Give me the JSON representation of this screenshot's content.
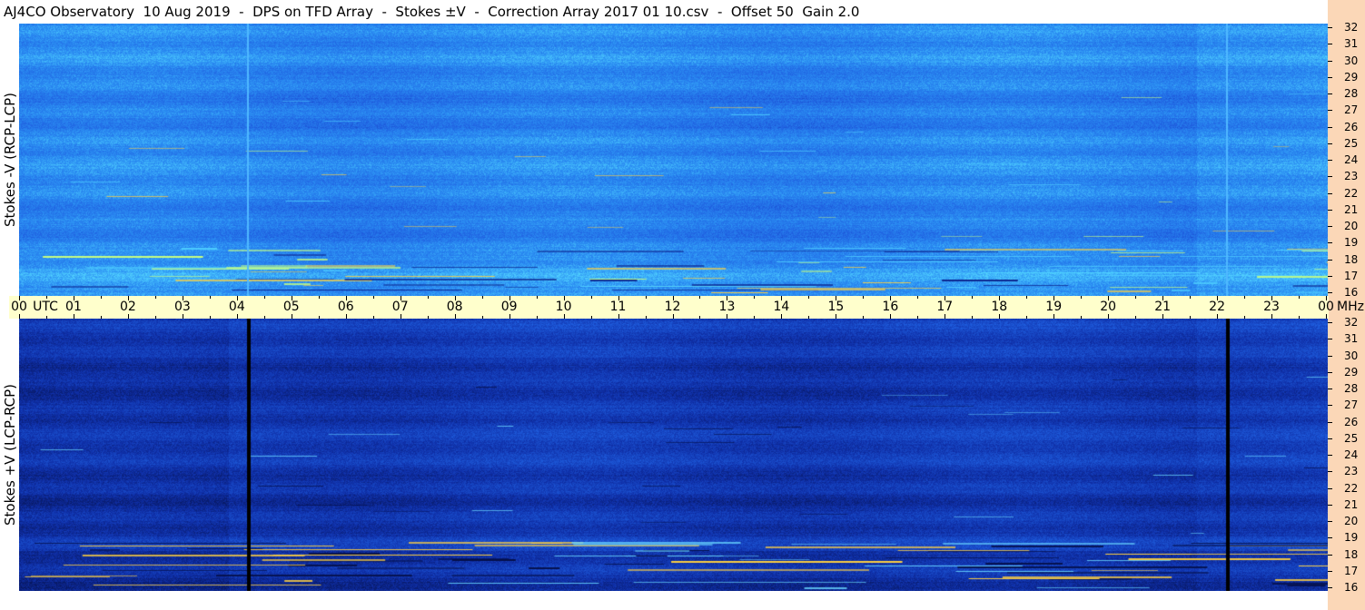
{
  "title": "AJ4CO Observatory  10 Aug 2019  -  DPS on TFD Array  -  Stokes ±V  -  Correction Array 2017 01 10.csv  -  Offset 50  Gain 2.0",
  "chart_data": [
    {
      "type": "heatmap",
      "panel": "top",
      "ylabel": "Stokes -V (RCP-LCP)",
      "x_unit": "UTC",
      "x_ticks": [
        "00",
        "01",
        "02",
        "03",
        "04",
        "05",
        "06",
        "07",
        "08",
        "09",
        "10",
        "11",
        "12",
        "13",
        "14",
        "15",
        "16",
        "17",
        "18",
        "19",
        "20",
        "21",
        "22",
        "23",
        "00"
      ],
      "y_unit": "MHz",
      "y_ticks": [
        "16",
        "17",
        "18",
        "19",
        "20",
        "21",
        "22",
        "23",
        "24",
        "25",
        "26",
        "27",
        "28",
        "29",
        "30",
        "31",
        "32"
      ],
      "xlim": [
        0,
        24
      ],
      "ylim": [
        16,
        32
      ],
      "colormap": [
        "#0a1f8a",
        "#1f5fe0",
        "#2a8cf2",
        "#4fd0ff",
        "#c8ff80",
        "#ffd040"
      ],
      "base_color": "#2a7ee8",
      "vertical_lines_utc": [
        4.2,
        22.15
      ],
      "vertical_line_color": "#4fb8ff"
    },
    {
      "type": "heatmap",
      "panel": "bottom",
      "ylabel": "Stokes +V (LCP-RCP)",
      "x_unit": "UTC",
      "x_ticks": [
        "00",
        "01",
        "02",
        "03",
        "04",
        "05",
        "06",
        "07",
        "08",
        "09",
        "10",
        "11",
        "12",
        "13",
        "14",
        "15",
        "16",
        "17",
        "18",
        "19",
        "20",
        "21",
        "22",
        "23",
        "00"
      ],
      "y_unit": "MHz",
      "y_ticks": [
        "16",
        "17",
        "18",
        "19",
        "20",
        "21",
        "22",
        "23",
        "24",
        "25",
        "26",
        "27",
        "28",
        "29",
        "30",
        "31",
        "32"
      ],
      "xlim": [
        0,
        24
      ],
      "ylim": [
        16,
        32
      ],
      "colormap": [
        "#05104a",
        "#0f2fa8",
        "#1f5fe0",
        "#3a9af5",
        "#6ad8ff"
      ],
      "base_color": "#1e66e4",
      "vertical_lines_utc": [
        4.2,
        22.15
      ],
      "vertical_line_color": "#000000"
    }
  ],
  "x_axis_labels": {
    "utc_label": "UTC",
    "mhz_label": "MHz"
  }
}
